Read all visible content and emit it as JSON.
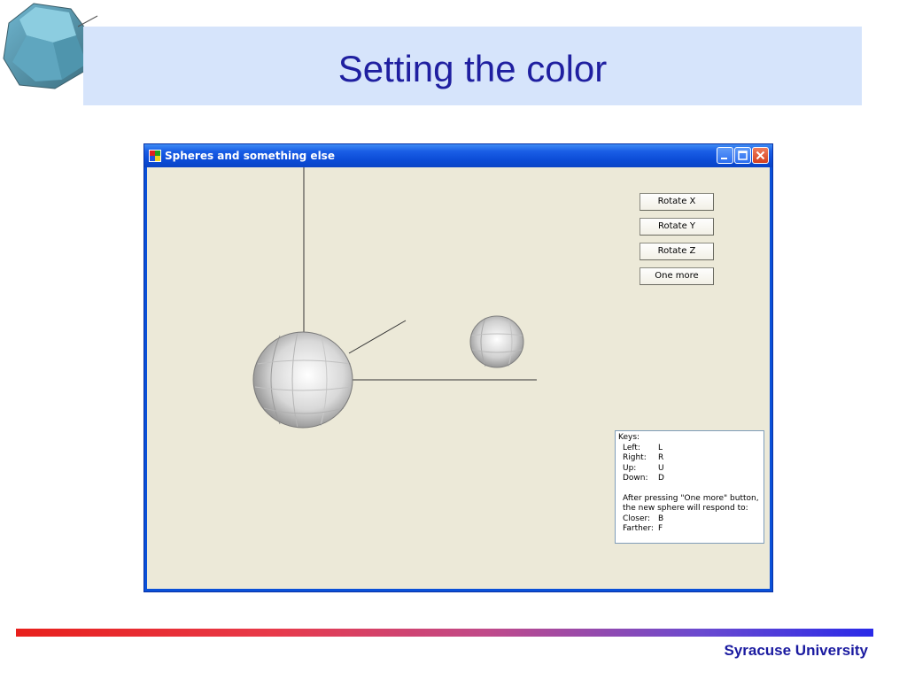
{
  "slide": {
    "title": "Setting the color",
    "footer": "Syracuse University"
  },
  "window": {
    "title": "Spheres and something else",
    "controls": [
      "minimize-icon",
      "maximize-icon",
      "close-icon"
    ]
  },
  "buttons": {
    "rotate_x": "Rotate X",
    "rotate_y": "Rotate Y",
    "rotate_z": "Rotate Z",
    "one_more": "One more"
  },
  "keys_box": {
    "heading": "Keys:",
    "keys": [
      {
        "label": "Left:",
        "key": "L"
      },
      {
        "label": "Right:",
        "key": "R"
      },
      {
        "label": "Up:",
        "key": "U"
      },
      {
        "label": "Down:",
        "key": "D"
      }
    ],
    "note_line1": "After pressing \"One more\" button,",
    "note_line2": "the new sphere will respond to:",
    "extra_keys": [
      {
        "label": "Closer:",
        "key": "B"
      },
      {
        "label": "Farther:",
        "key": "F"
      }
    ]
  },
  "colors": {
    "title_band": "#d6e4fb",
    "title_text": "#1f1fa0",
    "window_bg": "#ece9d8",
    "titlebar": "#0a50d8"
  }
}
